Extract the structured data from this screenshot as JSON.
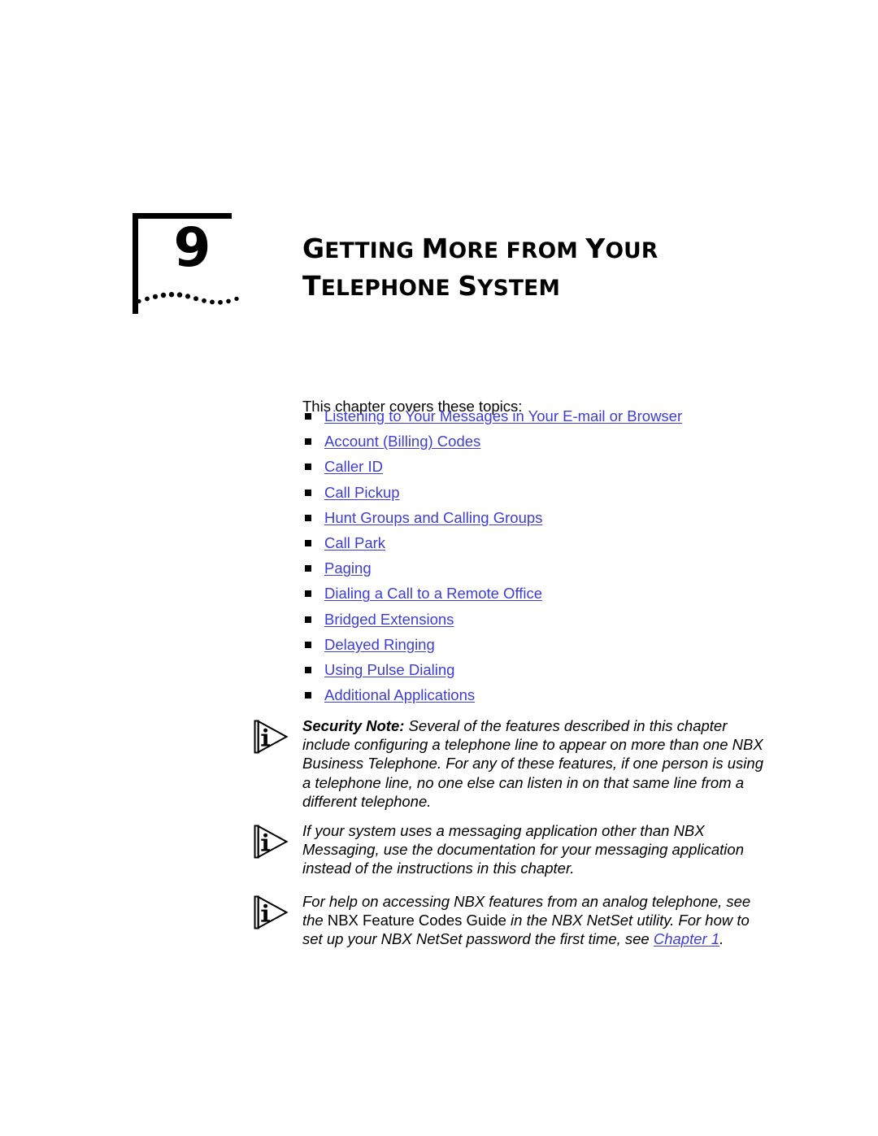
{
  "chapter": {
    "number": "9",
    "title_line1": {
      "parts": [
        {
          "text": "G",
          "style": "cap"
        },
        {
          "text": "ETTING ",
          "style": "sc"
        },
        {
          "text": "M",
          "style": "cap"
        },
        {
          "text": "ORE FROM ",
          "style": "sc"
        },
        {
          "text": "Y",
          "style": "cap"
        },
        {
          "text": "OUR",
          "style": "sc"
        }
      ]
    },
    "title_line2": {
      "parts": [
        {
          "text": "T",
          "style": "cap"
        },
        {
          "text": "ELEPHONE ",
          "style": "sc"
        },
        {
          "text": "S",
          "style": "cap"
        },
        {
          "text": "YSTEM",
          "style": "sc"
        }
      ]
    },
    "title_plain": "Getting More from Your Telephone System",
    "decoration": "dotted-wave"
  },
  "intro": {
    "text": "This chapter covers these topics:"
  },
  "topics": [
    {
      "label": "Listening to Your Messages in Your E-mail or Browser"
    },
    {
      "label": "Account (Billing) Codes"
    },
    {
      "label": "Caller ID"
    },
    {
      "label": "Call Pickup"
    },
    {
      "label": "Hunt Groups and Calling Groups"
    },
    {
      "label": "Call Park"
    },
    {
      "label": "Paging"
    },
    {
      "label": "Dialing a Call to a Remote Office"
    },
    {
      "label": "Bridged Extensions"
    },
    {
      "label": "Delayed Ringing"
    },
    {
      "label": "Using Pulse Dialing"
    },
    {
      "label": "Additional Applications"
    }
  ],
  "notes": {
    "security": {
      "icon": "info-note-icon",
      "lead": "Security Note:",
      "text": " Several of the features described in this chapter include configuring a telephone line to appear on more than one NBX Business Telephone. For any of these features, if one person is using a telephone line, no one else can listen in on that same line from a different telephone."
    },
    "messaging": {
      "icon": "info-note-icon",
      "text": "If your system uses a messaging application other than NBX Messaging, use the documentation for your messaging application instead of the instructions in this chapter."
    },
    "analog": {
      "icon": "info-note-icon",
      "text_part1": "For help on accessing NBX features from an analog telephone, see the ",
      "text_upright": "NBX Feature Codes Guide",
      "text_part2": " in the NBX NetSet utility. For how to set up your NBX NetSet password the first time, see ",
      "link": "Chapter 1",
      "text_end": "."
    }
  },
  "colors": {
    "link": "#3d3dd4",
    "text": "#000000",
    "page_background": "#ffffff"
  }
}
